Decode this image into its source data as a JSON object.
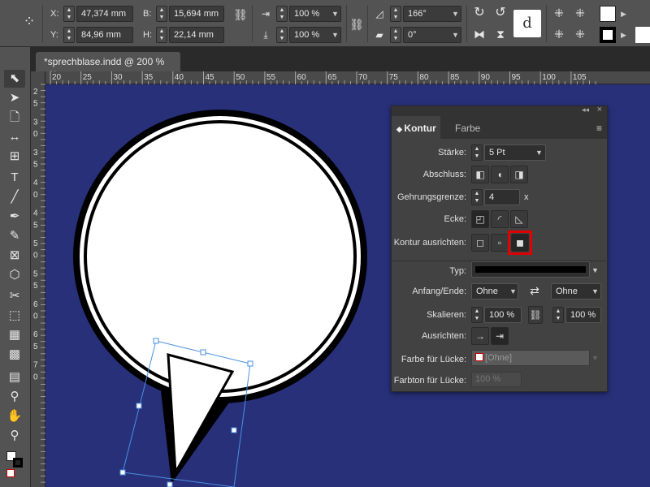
{
  "control": {
    "x_label": "X:",
    "x_value": "47,374 mm",
    "y_label": "Y:",
    "y_value": "84,96 mm",
    "b_label": "B:",
    "b_value": "15,694 mm",
    "h_label": "H:",
    "h_value": "22,14 mm",
    "scale_x": "100 %",
    "scale_y": "100 %",
    "rotation": "166°",
    "shear": "0°"
  },
  "document": {
    "tab_label": "*sprechblase.indd @ 200 %",
    "close_glyph": "×",
    "panel_collapse": "»"
  },
  "ruler": {
    "h_ticks": [
      "20",
      "25",
      "30",
      "35",
      "40",
      "45",
      "50",
      "55",
      "60",
      "65",
      "70",
      "75",
      "80",
      "85",
      "90",
      "95",
      "100",
      "105"
    ],
    "v_ticks": [
      "2",
      "5",
      "3",
      "0",
      "3",
      "5",
      "4",
      "0",
      "4",
      "5",
      "5",
      "0",
      "5",
      "5",
      "6",
      "0",
      "6",
      "5",
      "7",
      "0"
    ]
  },
  "panel": {
    "tab_active": "Kontur",
    "tab_other": "Farbe",
    "staerke_label": "Stärke:",
    "staerke_value": "5 Pt",
    "abschluss_label": "Abschluss:",
    "gehrung_label": "Gehrungsgrenze:",
    "gehrung_value": "4",
    "gehrung_unit": "x",
    "ecke_label": "Ecke:",
    "ausrichten_label": "Kontur ausrichten:",
    "typ_label": "Typ:",
    "anfang_label": "Anfang/Ende:",
    "anfang_value": "Ohne",
    "ende_value": "Ohne",
    "skalieren_label": "Skalieren:",
    "skal_1": "100 %",
    "skal_2": "100 %",
    "ausrichten2_label": "Ausrichten:",
    "luecke_label": "Farbe für Lücke:",
    "luecke_value": "[Ohne]",
    "farbton_label": "Farbton für Lücke:",
    "farbton_value": "100 %"
  },
  "colors": {
    "canvas": "#28307a",
    "highlight": "#e00000",
    "selection": "#4a90e2"
  }
}
